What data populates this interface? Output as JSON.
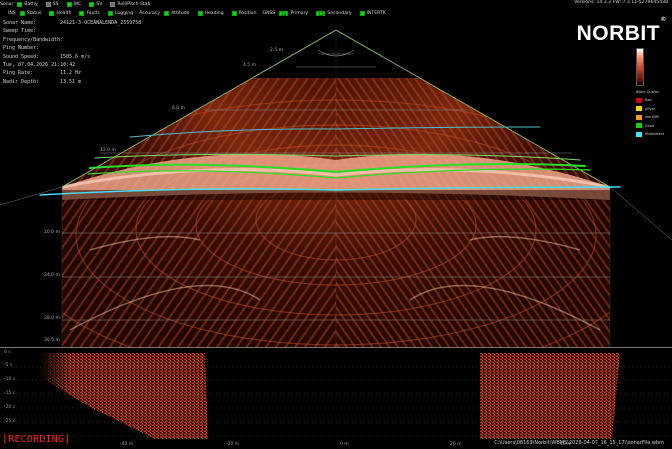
{
  "toolbar1": {
    "title": "Sonar",
    "items": [
      {
        "label": "Bathy",
        "state": "on"
      },
      {
        "label": "SS",
        "state": "grey"
      },
      {
        "label": "WC",
        "state": "on"
      },
      {
        "label": "SV",
        "state": "on"
      },
      {
        "label": "Roll/Pitch Stab",
        "state": "grey"
      }
    ]
  },
  "toolbar2": {
    "title": "INS",
    "ins_items": [
      {
        "label": "Status",
        "state": "on"
      },
      {
        "label": "Health",
        "state": "on"
      },
      {
        "label": "Faults",
        "state": "on"
      },
      {
        "label": "Logging",
        "state": "on"
      }
    ],
    "accuracy_title": "Accuracy",
    "accuracy_items": [
      {
        "label": "Attitude",
        "state": "on"
      },
      {
        "label": "Heading",
        "state": "on"
      },
      {
        "label": "Position",
        "state": "on"
      }
    ],
    "gnss_title": "GNSS",
    "gnss_items": [
      {
        "label": "Primary",
        "value": "14",
        "state": "on"
      },
      {
        "label": "Secondary",
        "value": "12",
        "state": "on"
      }
    ],
    "intertk": {
      "label": "INTERTK",
      "state": "on"
    }
  },
  "version": "Versions: 14.3.3 FW: 7.3.11-5279645438",
  "info": [
    {
      "key": "Sonar Name:",
      "value": "24121-3-OCEANALENDA_2559758"
    },
    {
      "key": "Sweep Time:",
      "value": ""
    },
    {
      "key": "Frequency/Bandwidth:",
      "value": ""
    },
    {
      "key": "Ping Number:",
      "value": ""
    },
    {
      "key": "Sound Speed:",
      "value": "1505.6 m/s"
    },
    {
      "key": "Tue, 07.04.2026 21:10:42",
      "value": ""
    },
    {
      "key": "Ping Rate:",
      "value": "11.2 Hz"
    },
    {
      "key": "Nadir Depth:",
      "value": "13.51 m"
    }
  ],
  "logo": {
    "text": "NORBIT",
    "mark": "®"
  },
  "colorbar": {
    "top_tick": "",
    "bottom_tick": ""
  },
  "legend": {
    "title": "Beam Quality",
    "items": [
      {
        "label": "Bad",
        "color": "#d40000"
      },
      {
        "label": "Aflyer",
        "color": "#ffd200"
      },
      {
        "label": "low SNR",
        "color": "#ff9a20"
      },
      {
        "label": "Good",
        "color": "#19d019"
      },
      {
        "label": "Multidetect",
        "color": "#3fe6ff"
      }
    ]
  },
  "range_labels": [
    "2.5 m",
    "4.5 m",
    "8.0 m",
    "12.0 m",
    "20.0 m",
    "24.0 m",
    "28.0 m",
    "30.5 m"
  ],
  "status": {
    "recording": "[RECORDING]",
    "file_path": "C:\\Users\\08169\\Norbit\\WBMS\\2026-04-07_16_15_17\\\\sonarFile.wbm"
  },
  "waterfall_axis": [
    "0 s",
    "-5 s",
    "-10 s",
    "-15 s",
    "-20 s",
    "-25 s"
  ],
  "waterfall_x_axis": [
    "-40 m",
    "-20 m",
    "0 m",
    "20 m",
    "40 m"
  ]
}
